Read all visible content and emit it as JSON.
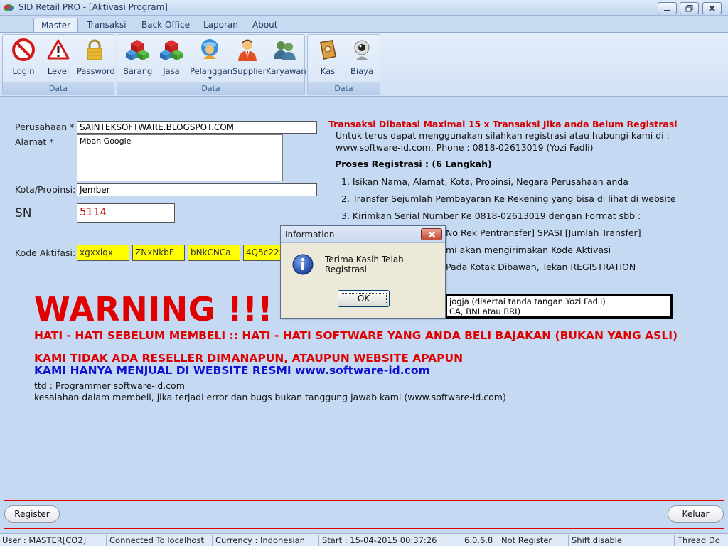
{
  "window": {
    "title": "SID Retail PRO - [Aktivasi Program]"
  },
  "ribbon": {
    "tabs": [
      "Master",
      "Transaksi",
      "Back Office",
      "Laporan",
      "About"
    ],
    "groups": [
      {
        "label": "Data",
        "buttons": [
          "Login",
          "Level",
          "Password"
        ]
      },
      {
        "label": "Data",
        "buttons": [
          "Barang",
          "Jasa",
          "Pelanggan",
          "Supplier",
          "Karyawan"
        ]
      },
      {
        "label": "Data",
        "buttons": [
          "Kas",
          "Biaya"
        ]
      }
    ]
  },
  "form": {
    "perusahaan_label": "Perusahaan *",
    "perusahaan_value": "SAINTEKSOFTWARE.BLOGSPOT.COM",
    "alamat_label": "Alamat *",
    "alamat_value": "Mbah Google",
    "kota_label": "Kota/Propinsi:",
    "kota_value": "Jember",
    "sn_label": "SN",
    "sn_value": "5114",
    "kode_label": "Kode Aktifasi:",
    "kode_values": [
      "xgxxiqx",
      "ZNxNkbF",
      "bNkCNCa",
      "4Q5c225"
    ]
  },
  "info": {
    "headline": "Transaksi Dibatasi Maximal 15 x Transaksi Jika anda Belum Registrasi",
    "line1": "Untuk terus dapat menggunakan silahkan registrasi atau hubungi kami di :",
    "line2": "www.software-id.com, Phone : 0818-02613019 (Yozi Fadli)",
    "proses_title": "Proses Registrasi : (6 Langkah)",
    "steps": [
      "1. Isikan Nama, Alamat, Kota, Propinsi, Negara Perusahaan anda",
      "2. Transfer Sejumlah Pembayaran Ke Rekening yang bisa di lihat di website",
      "3. Kirimkan Serial Number Ke 0818-02613019 dengan Format sbb :",
      "No Rek Pentransfer] SPASI [Jumlah Transfer]",
      "mi akan mengirimakan Kode Aktivasi",
      "Pada Kotak Dibawah, Tekan REGISTRATION"
    ],
    "box_line1": "jogja (disertai tanda tangan Yozi Fadli)",
    "box_line2": "CA, BNI atau BRI)"
  },
  "warning": {
    "title": "WARNING !!!",
    "line1": "HATI - HATI SEBELUM MEMBELI :: HATI - HATI SOFTWARE YANG ANDA BELI BAJAKAN (BUKAN YANG ASLI)",
    "line2": "KAMI TIDAK ADA RESELLER DIMANAPUN, ATAUPUN WEBSITE APAPUN",
    "line3": "KAMI HANYA MENJUAL DI WEBSITE RESMI www.software-id.com",
    "ttd": "ttd : Programmer software-id.com",
    "disclaimer": "kesalahan dalam membeli, jika terjadi error dan bugs bukan tanggung jawab kami (www.software-id.com)"
  },
  "buttons": {
    "register": "Register",
    "keluar": "Keluar"
  },
  "statusbar": {
    "user": "User : MASTER[CO2]",
    "connection": "Connected To localhost",
    "currency": "Currency : Indonesian",
    "start": "Start  : 15-04-2015 00:37:26",
    "version": "6.0.6.8",
    "register_status": "Not Register",
    "shift": "Shift disable",
    "thread": "Thread Do"
  },
  "dialog": {
    "title": "Information",
    "message": "Terima Kasih Telah Registrasi",
    "ok": "OK"
  },
  "colors": {
    "background": "#c5d9f3",
    "warning_red": "#e00000",
    "link_blue": "#1010d0",
    "code_yellow": "#ffff00"
  }
}
